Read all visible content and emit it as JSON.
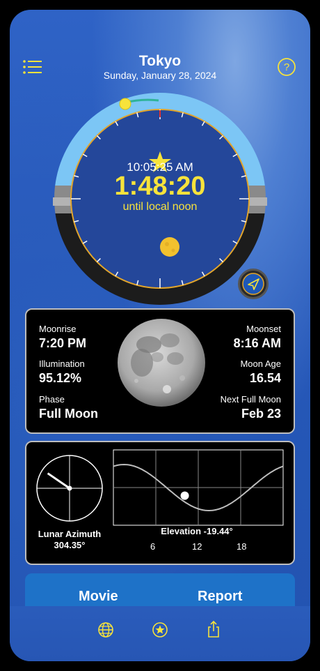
{
  "header": {
    "city": "Tokyo",
    "date": "Sunday, January 28, 2024"
  },
  "clock": {
    "current_time": "10:05:25 AM",
    "countdown": "1:48:20",
    "countdown_caption": "until local noon"
  },
  "moon_panel": {
    "moonrise_label": "Moonrise",
    "moonrise_value": "7:20 PM",
    "moonset_label": "Moonset",
    "moonset_value": "8:16 AM",
    "illumination_label": "Illumination",
    "illumination_value": "95.12%",
    "moon_age_label": "Moon Age",
    "moon_age_value": "16.54",
    "phase_label": "Phase",
    "phase_value": "Full Moon",
    "next_full_label": "Next Full Moon",
    "next_full_value": "Feb 23"
  },
  "position_panel": {
    "azimuth_label": "Lunar Azimuth",
    "azimuth_value": "304.35°",
    "azimuth_degrees": 304.35,
    "elevation_label": "Elevation -19.44°",
    "elevation_degrees": -19.44,
    "x_ticks": [
      "6",
      "12",
      "18"
    ]
  },
  "buttons": {
    "movie": "Movie",
    "report": "Report"
  },
  "icons": {
    "menu": "menu-icon",
    "help": "help-icon",
    "locate": "location-arrow-icon",
    "globe": "globe-icon",
    "favorite": "star-circle-icon",
    "share": "share-icon"
  },
  "colors": {
    "accent_yellow": "#f7e33b",
    "day_arc": "#7cc6f5",
    "night_arc": "#1a1a1a",
    "dial_face": "#24479a",
    "button_blue": "#1e72c8"
  }
}
